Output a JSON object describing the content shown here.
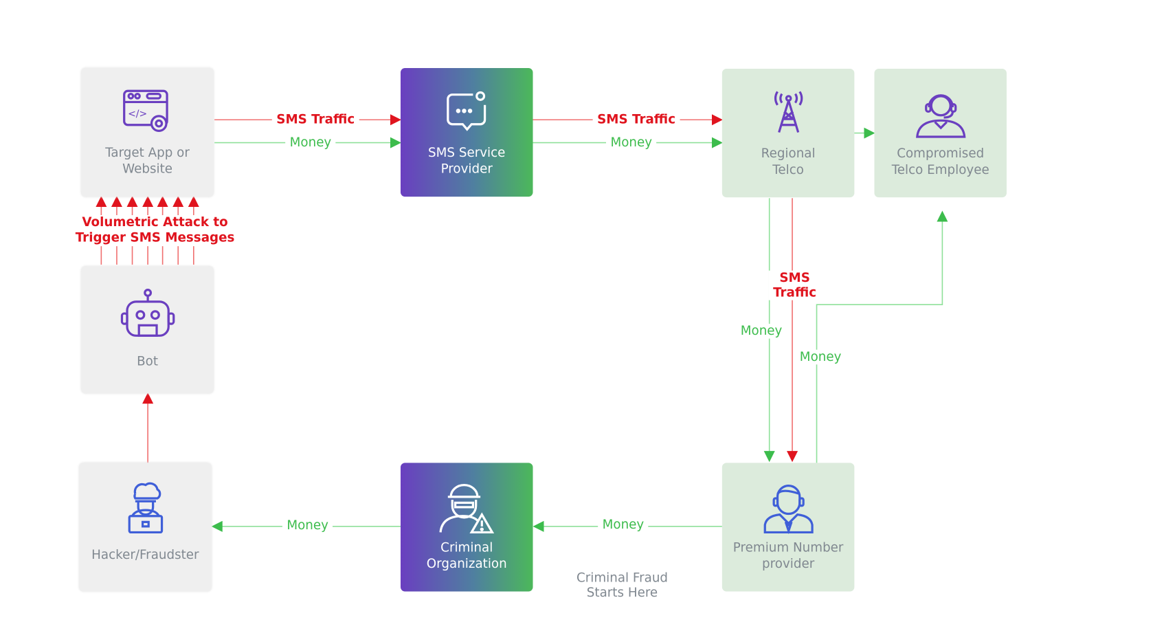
{
  "colors": {
    "sms_traffic": "#e0141e",
    "money": "#3cbc4c",
    "icon": "#6a3fc0",
    "node_grey": "#efefef",
    "node_green": "#dcebdc"
  },
  "nodes": {
    "target_app": {
      "label": "Target App or\nWebsite",
      "icon": "web-app-gear-icon"
    },
    "sms_provider": {
      "label": "SMS Service\nProvider",
      "icon": "chat-bubble-icon"
    },
    "regional_telco": {
      "label": "Regional\nTelco",
      "icon": "cell-tower-icon"
    },
    "compromised_employee": {
      "label": "Compromised\nTelco Employee",
      "icon": "headset-agent-icon"
    },
    "bot": {
      "label": "Bot",
      "icon": "robot-icon"
    },
    "hacker": {
      "label": "Hacker/Fraudster",
      "icon": "hacker-laptop-icon"
    },
    "criminal_org": {
      "label": "Criminal\nOrganization",
      "icon": "masked-criminal-icon"
    },
    "premium_provider": {
      "label": "Premium Number\nprovider",
      "icon": "businessman-icon"
    }
  },
  "edges": {
    "sms1": "SMS Traffic",
    "money1": "Money",
    "sms2": "SMS Traffic",
    "money2": "Money",
    "sms3": "SMS\nTraffic",
    "money3": "Money",
    "money4": "Money",
    "money5": "Money",
    "money6": "Money",
    "attack": "Volumetric Attack to\nTrigger SMS Messages"
  },
  "annotations": {
    "start": "Criminal Fraud\nStarts Here"
  }
}
